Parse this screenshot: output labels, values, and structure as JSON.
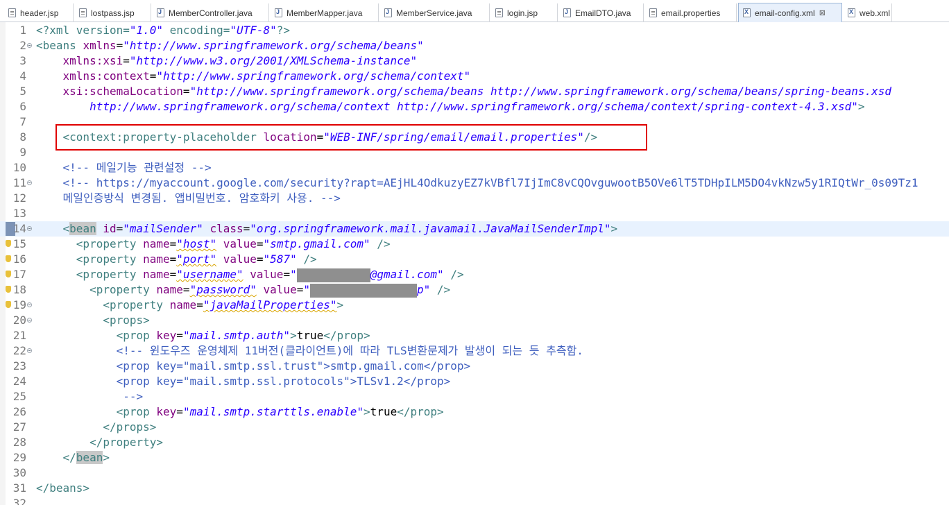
{
  "tabs": [
    {
      "label": "header.jsp",
      "icon": "jsp-file-icon",
      "active": false
    },
    {
      "label": "lostpass.jsp",
      "icon": "jsp-file-icon",
      "active": false
    },
    {
      "label": "MemberController.java",
      "icon": "java-file-icon",
      "active": false
    },
    {
      "label": "MemberMapper.java",
      "icon": "java-file-icon",
      "active": false
    },
    {
      "label": "MemberService.java",
      "icon": "java-file-icon",
      "active": false
    },
    {
      "label": "login.jsp",
      "icon": "jsp-file-icon",
      "active": false
    },
    {
      "label": "EmailDTO.java",
      "icon": "java-file-icon",
      "active": false
    },
    {
      "label": "email.properties",
      "icon": "properties-file-icon",
      "active": false
    },
    {
      "label": "email-config.xml",
      "icon": "xml-file-icon",
      "active": true,
      "close": "⊠"
    },
    {
      "label": "web.xml",
      "icon": "xml-file-icon",
      "active": false
    }
  ],
  "editor": {
    "highlight_color": "#e00000",
    "lines": [
      {
        "n": "1",
        "segs": [
          [
            "pi",
            "<?xml version="
          ],
          [
            "val",
            "\"1.0\""
          ],
          [
            "pi",
            " encoding="
          ],
          [
            "val",
            "\"UTF-8\""
          ],
          [
            "pi",
            "?>"
          ]
        ]
      },
      {
        "n": "2",
        "fold": true,
        "segs": [
          [
            "tag",
            "<beans "
          ],
          [
            "attr",
            "xmlns"
          ],
          [
            "txt",
            "="
          ],
          [
            "val",
            "\"http://www.springframework.org/schema/beans\""
          ]
        ]
      },
      {
        "n": "3",
        "segs": [
          [
            "txt",
            "    "
          ],
          [
            "attr",
            "xmlns:xsi"
          ],
          [
            "txt",
            "="
          ],
          [
            "val",
            "\"http://www.w3.org/2001/XMLSchema-instance\""
          ]
        ]
      },
      {
        "n": "4",
        "segs": [
          [
            "txt",
            "    "
          ],
          [
            "attr",
            "xmlns:context"
          ],
          [
            "txt",
            "="
          ],
          [
            "val",
            "\"http://www.springframework.org/schema/context\""
          ]
        ]
      },
      {
        "n": "5",
        "segs": [
          [
            "txt",
            "    "
          ],
          [
            "attr",
            "xsi:schemaLocation"
          ],
          [
            "txt",
            "="
          ],
          [
            "val",
            "\"http://www.springframework.org/schema/beans http://www.springframework.org/schema/beans/spring-beans.xsd"
          ]
        ]
      },
      {
        "n": "6",
        "segs": [
          [
            "txt",
            "        "
          ],
          [
            "val",
            "http://www.springframework.org/schema/context http://www.springframework.org/schema/context/spring-context-4.3.xsd\""
          ],
          [
            "tag",
            ">"
          ]
        ]
      },
      {
        "n": "7",
        "segs": []
      },
      {
        "n": "8",
        "segs": [
          [
            "txt",
            "    "
          ],
          [
            "tag",
            "<context:property-placeholder "
          ],
          [
            "attr",
            "location"
          ],
          [
            "txt",
            "="
          ],
          [
            "val",
            "\"WEB-INF/spring/email/email.properties\""
          ],
          [
            "tag",
            "/>"
          ]
        ]
      },
      {
        "n": "9",
        "segs": []
      },
      {
        "n": "10",
        "segs": [
          [
            "txt",
            "    "
          ],
          [
            "cmt",
            "<!-- 메일기능 관련설정 -->"
          ]
        ]
      },
      {
        "n": "11",
        "fold": true,
        "segs": [
          [
            "txt",
            "    "
          ],
          [
            "cmt",
            "<!-- https://myaccount.google.com/security?rapt=AEjHL4OdkuzyEZ7kVBfl7IjImC8vCQOvguwootB5OVe6lT5TDHpILM5DO4vkNzw5y1RIQtWr_0s09Tz1"
          ]
        ]
      },
      {
        "n": "12",
        "segs": [
          [
            "txt",
            "    "
          ],
          [
            "cmt",
            "메일인증방식 변경됨. 앱비밀번호. 암호화키 사용. -->"
          ]
        ]
      },
      {
        "n": "13",
        "segs": []
      },
      {
        "n": "14",
        "fold": true,
        "marker": true,
        "current": true,
        "segs": [
          [
            "txt",
            "    "
          ],
          [
            "tag",
            "<"
          ],
          [
            "hltag",
            "bean"
          ],
          [
            "tag",
            " "
          ],
          [
            "attr",
            "id"
          ],
          [
            "txt",
            "="
          ],
          [
            "val",
            "\"mailSender\""
          ],
          [
            "tag",
            " "
          ],
          [
            "attr",
            "class"
          ],
          [
            "txt",
            "="
          ],
          [
            "val",
            "\"org.springframework.mail.javamail.JavaMailSenderImpl\""
          ],
          [
            "tag",
            ">"
          ]
        ]
      },
      {
        "n": "15",
        "warn": true,
        "segs": [
          [
            "txt",
            "      "
          ],
          [
            "tag",
            "<property "
          ],
          [
            "attr",
            "name"
          ],
          [
            "txt",
            "="
          ],
          [
            "valsq",
            "\"host\""
          ],
          [
            "tag",
            " "
          ],
          [
            "attr",
            "value"
          ],
          [
            "txt",
            "="
          ],
          [
            "val",
            "\"smtp.gmail.com\""
          ],
          [
            "tag",
            " />"
          ]
        ]
      },
      {
        "n": "16",
        "warn": true,
        "segs": [
          [
            "txt",
            "      "
          ],
          [
            "tag",
            "<property "
          ],
          [
            "attr",
            "name"
          ],
          [
            "txt",
            "="
          ],
          [
            "valsq",
            "\"port\""
          ],
          [
            "tag",
            " "
          ],
          [
            "attr",
            "value"
          ],
          [
            "txt",
            "="
          ],
          [
            "val",
            "\"587\""
          ],
          [
            "tag",
            " />"
          ]
        ]
      },
      {
        "n": "17",
        "warn": true,
        "segs": [
          [
            "txt",
            "      "
          ],
          [
            "tag",
            "<property "
          ],
          [
            "attr",
            "name"
          ],
          [
            "txt",
            "="
          ],
          [
            "valsq",
            "\"username\""
          ],
          [
            "tag",
            " "
          ],
          [
            "attr",
            "value"
          ],
          [
            "txt",
            "="
          ],
          [
            "val",
            "\""
          ],
          [
            "redact",
            "         "
          ],
          [
            "val",
            "@gmail.com\""
          ],
          [
            "tag",
            " />"
          ]
        ]
      },
      {
        "n": "18",
        "warn": true,
        "segs": [
          [
            "txt",
            "        "
          ],
          [
            "tag",
            "<property "
          ],
          [
            "attr",
            "name"
          ],
          [
            "txt",
            "="
          ],
          [
            "valsq",
            "\"password\""
          ],
          [
            "tag",
            " "
          ],
          [
            "attr",
            "value"
          ],
          [
            "txt",
            "="
          ],
          [
            "val",
            "\""
          ],
          [
            "redact",
            "                "
          ],
          [
            "val",
            "p\""
          ],
          [
            "tag",
            " />"
          ]
        ]
      },
      {
        "n": "19",
        "fold": true,
        "warn": true,
        "segs": [
          [
            "txt",
            "          "
          ],
          [
            "tag",
            "<property "
          ],
          [
            "attr",
            "name"
          ],
          [
            "txt",
            "="
          ],
          [
            "valsq",
            "\"javaMailProperties\""
          ],
          [
            "tag",
            ">"
          ]
        ]
      },
      {
        "n": "20",
        "fold": true,
        "segs": [
          [
            "txt",
            "          "
          ],
          [
            "tag",
            "<props>"
          ]
        ]
      },
      {
        "n": "21",
        "segs": [
          [
            "txt",
            "            "
          ],
          [
            "tag",
            "<prop "
          ],
          [
            "attr",
            "key"
          ],
          [
            "txt",
            "="
          ],
          [
            "val",
            "\"mail.smtp.auth\""
          ],
          [
            "tag",
            ">"
          ],
          [
            "txt",
            "true"
          ],
          [
            "tag",
            "</prop>"
          ]
        ]
      },
      {
        "n": "22",
        "fold": true,
        "segs": [
          [
            "txt",
            "            "
          ],
          [
            "cmt",
            "<!-- 윈도우즈 운영체제 11버전(클라이언트)에 따라 TLS변환문제가 발생이 되는 듯 추측함."
          ]
        ]
      },
      {
        "n": "23",
        "segs": [
          [
            "txt",
            "            "
          ],
          [
            "cmt",
            "<prop key=\"mail.smtp.ssl.trust\">smtp.gmail.com</prop>"
          ]
        ]
      },
      {
        "n": "24",
        "segs": [
          [
            "txt",
            "            "
          ],
          [
            "cmt",
            "<prop key=\"mail.smtp.ssl.protocols\">TLSv1.2</prop>"
          ]
        ]
      },
      {
        "n": "25",
        "segs": [
          [
            "txt",
            "             "
          ],
          [
            "cmt",
            "-->"
          ]
        ]
      },
      {
        "n": "26",
        "segs": [
          [
            "txt",
            "            "
          ],
          [
            "tag",
            "<prop "
          ],
          [
            "attr",
            "key"
          ],
          [
            "txt",
            "="
          ],
          [
            "val",
            "\"mail.smtp.starttls.enable\""
          ],
          [
            "tag",
            ">"
          ],
          [
            "txt",
            "true"
          ],
          [
            "tag",
            "</prop>"
          ]
        ]
      },
      {
        "n": "27",
        "segs": [
          [
            "txt",
            "          "
          ],
          [
            "tag",
            "</props>"
          ]
        ]
      },
      {
        "n": "28",
        "segs": [
          [
            "txt",
            "        "
          ],
          [
            "tag",
            "</property>"
          ]
        ]
      },
      {
        "n": "29",
        "segs": [
          [
            "txt",
            "    "
          ],
          [
            "tag",
            "</"
          ],
          [
            "hltag",
            "bean"
          ],
          [
            "tag",
            ">"
          ]
        ]
      },
      {
        "n": "30",
        "segs": []
      },
      {
        "n": "31",
        "segs": [
          [
            "tag",
            "</beans>"
          ]
        ]
      },
      {
        "n": "32",
        "segs": []
      }
    ]
  }
}
